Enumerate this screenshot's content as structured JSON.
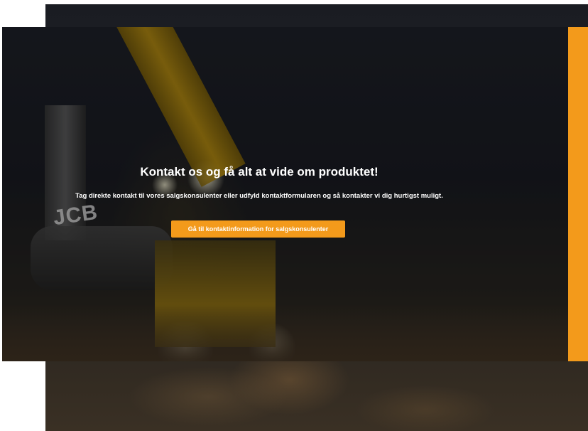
{
  "banner": {
    "headline": "Kontakt os og få alt at vide om produktet!",
    "subtext": "Tag direkte kontakt til vores salgskonsulenter eller udfyld kontaktformularen og så kontakter vi dig hurtigst muligt.",
    "cta_label": "Gå til kontaktinformation for salgskonsulenter",
    "photo_brand_text": "JCB"
  },
  "colors": {
    "accent": "#f39a1b",
    "headline_text": "#ffffff"
  }
}
